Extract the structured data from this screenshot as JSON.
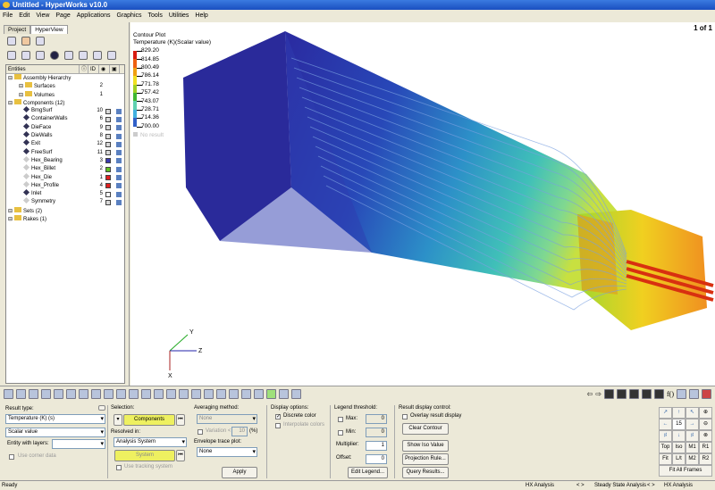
{
  "window": {
    "title": "Untitled - HyperWorks v10.0"
  },
  "menu": [
    "File",
    "Edit",
    "View",
    "Page",
    "Applications",
    "Graphics",
    "Tools",
    "Utilities",
    "Help"
  ],
  "left_panel": {
    "tabs": [
      "Project",
      "HyperView"
    ],
    "columns": [
      "Entities",
      "ID"
    ],
    "tree": [
      {
        "label": "Assembly Hierarchy",
        "level": 0
      },
      {
        "label": "Surfaces",
        "level": 1,
        "id": "2"
      },
      {
        "label": "Volumes",
        "level": 1,
        "id": "1"
      },
      {
        "label": "Components (12)",
        "level": 0
      },
      {
        "label": "BmgSurf",
        "level": 2,
        "id": "10",
        "color": "#d8d8d8"
      },
      {
        "label": "ContainerWalls",
        "level": 2,
        "id": "6",
        "color": "#d8d8d8"
      },
      {
        "label": "DieFace",
        "level": 2,
        "id": "9",
        "color": "#d8d8d8"
      },
      {
        "label": "DieWalls",
        "level": 2,
        "id": "8",
        "color": "#d8d8d8"
      },
      {
        "label": "Exit",
        "level": 2,
        "id": "12",
        "color": "#d8d8d8"
      },
      {
        "label": "FreeSurf",
        "level": 2,
        "id": "11",
        "color": "#d8d8d8"
      },
      {
        "label": "Hex_Bearing",
        "level": 2,
        "id": "3",
        "color": "#3a3ab0",
        "hollow": true
      },
      {
        "label": "Hex_Billet",
        "level": 2,
        "id": "2",
        "color": "#60c020",
        "hollow": true
      },
      {
        "label": "Hex_Die",
        "level": 2,
        "id": "1",
        "color": "#e02020",
        "hollow": true
      },
      {
        "label": "Hex_Profile",
        "level": 2,
        "id": "4",
        "color": "#e02020",
        "hollow": true
      },
      {
        "label": "Inlet",
        "level": 2,
        "id": "5",
        "color": "#ffffff"
      },
      {
        "label": "Symmetry",
        "level": 2,
        "id": "7",
        "color": "#d8d8d8",
        "hollow": true
      },
      {
        "label": "Sets (2)",
        "level": 0
      },
      {
        "label": "Rakes (1)",
        "level": 0
      }
    ]
  },
  "viewport": {
    "page_indicator": "1 of 1",
    "legend": {
      "title": "Contour Plot",
      "subtitle": "Temperature (K)(Scalar value)",
      "values": [
        "829.20",
        "814.85",
        "800.49",
        "786.14",
        "771.78",
        "757.42",
        "743.07",
        "728.71",
        "714.36",
        "700.00"
      ],
      "colors": [
        "#d81c10",
        "#ee6010",
        "#f0a010",
        "#f0e020",
        "#a0d020",
        "#40b830",
        "#60d0b0",
        "#40b0e0",
        "#3060c8",
        "#2020a0"
      ],
      "no_result": "No result"
    },
    "axes": {
      "y": "Y",
      "z": "Z",
      "x": "X"
    }
  },
  "panel": {
    "result_type_label": "Result type:",
    "result_type": "Temperature (K) (s)",
    "scalar": "Scalar value",
    "entity_layers_label": "Entity with layers:",
    "use_corner": "Use corner data",
    "selection_label": "Selection:",
    "components_btn": "Components",
    "resolved_label": "Resolved in:",
    "resolved": "Analysis System",
    "system_btn": "System",
    "use_tracking": "Use tracking system",
    "averaging_label": "Averaging method:",
    "averaging": "None",
    "variation_label": "Variation <",
    "variation_value": "10",
    "variation_unit": "(%)",
    "envelope_label": "Envelope trace plot:",
    "envelope": "None",
    "apply": "Apply",
    "display_label": "Display options:",
    "discrete": "Discrete color",
    "interpolate": "Interpolate colors",
    "threshold_label": "Legend threshold:",
    "max_label": "Max:",
    "max": "0",
    "min_label": "Min:",
    "min": "0",
    "multiplier_label": "Multiplier:",
    "multiplier": "1",
    "offset_label": "Offset:",
    "offset": "0",
    "edit_legend": "Edit Legend...",
    "rdc_label": "Result display control:",
    "overlay": "Overlay result display",
    "clear_contour": "Clear Contour",
    "show_iso": "Show Iso Value",
    "projection": "Projection Rule...",
    "query": "Query Results...",
    "nav": {
      "angle": "15",
      "top": "Top",
      "iso": "Iso",
      "m1": "M1",
      "r1": "R1",
      "fit": "Fit",
      "lr": "L/t",
      "m2": "M2",
      "r2": "R2",
      "fit_all": "Fit All Frames"
    },
    "toolbar_fx": "f()"
  },
  "status": {
    "left": "Ready",
    "s1": "HX Analysis",
    "s2": "Steady State Analysis",
    "s3": "HX Analysis"
  }
}
